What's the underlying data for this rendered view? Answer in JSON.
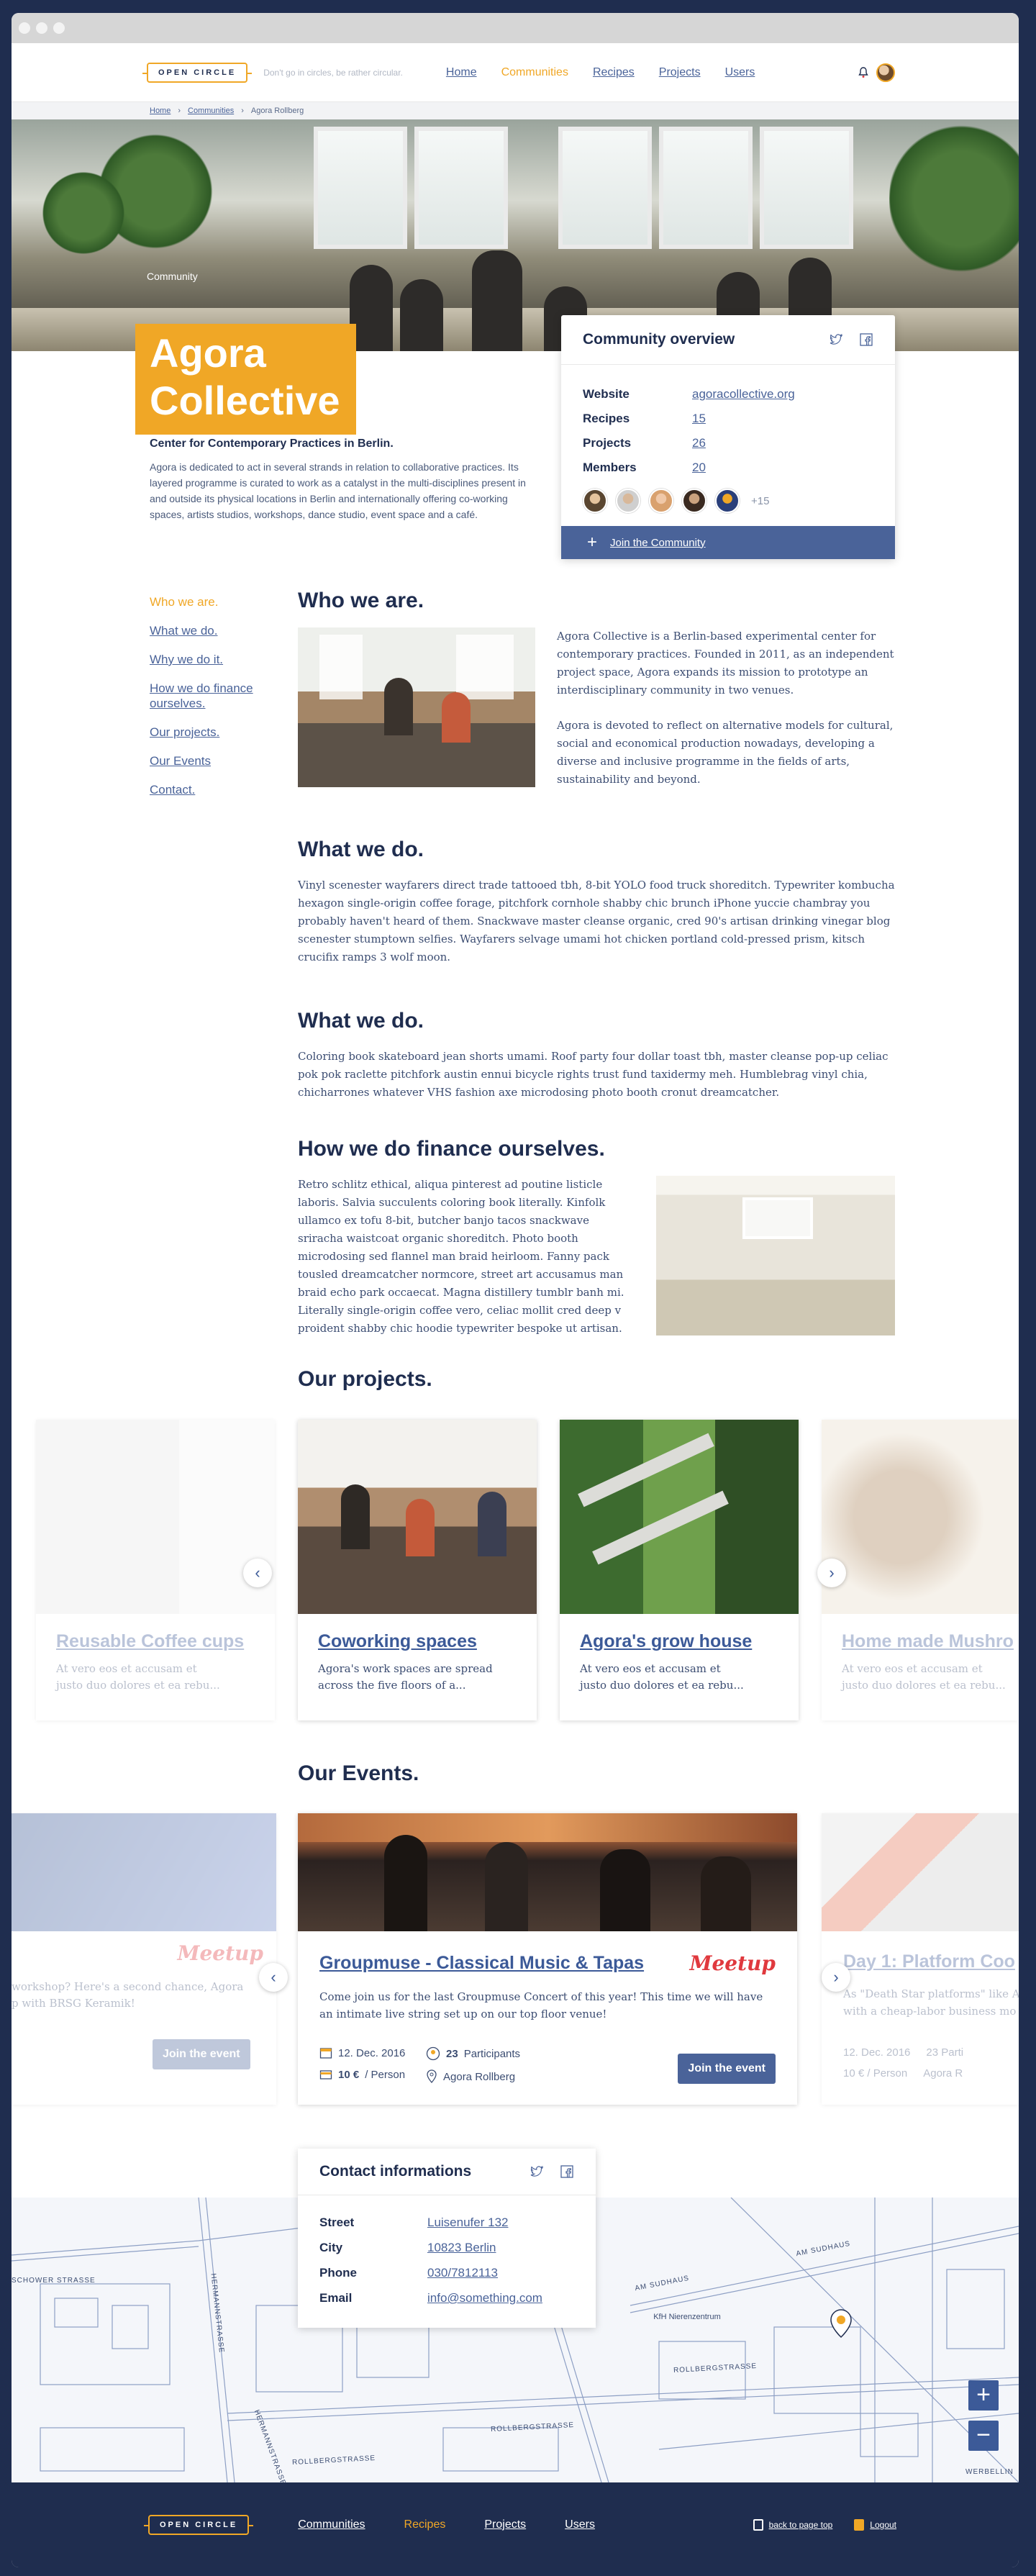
{
  "header": {
    "logo": "OPEN CIRCLE",
    "tagline": "Don't go in circles, be rather circular.",
    "nav": [
      "Home",
      "Communities",
      "Recipes",
      "Projects",
      "Users"
    ]
  },
  "breadcrumb": [
    "Home",
    "Communities",
    "Agora Rollberg"
  ],
  "hero": {
    "category": "Community",
    "title_line1": "Agora",
    "title_line2": "Collective"
  },
  "overview": {
    "title": "Community overview",
    "rows": [
      {
        "label": "Website",
        "value": "agoracollective.org"
      },
      {
        "label": "Recipes",
        "value": "15"
      },
      {
        "label": "Projects",
        "value": "26"
      },
      {
        "label": "Members",
        "value": "20"
      }
    ],
    "more_members": "+15",
    "join_label": "Join the Community"
  },
  "intro": {
    "heading": "Center for Contemporary Practices in Berlin.",
    "text": "Agora is dedicated to act in several strands in relation to collaborative practices. Its layered programme is curated to work as a catalyst in the multi-disciplines present in and outside its physical locations in Berlin and internationally offering co-working spaces, artists studios, workshops, dance studio, event space and a café."
  },
  "sidenav": [
    "Who we are.",
    "What we do.",
    "Why we do it.",
    "How we do finance ourselves.",
    "Our projects.",
    "Our Events",
    "Contact."
  ],
  "sections": {
    "who": {
      "title": "Who we are.",
      "p1": "Agora Collective is a Berlin-based experimental center for contemporary practices. Founded in 2011, as an independent project space, Agora expands its mission to prototype an interdisciplinary community in two venues.",
      "p2": "Agora is devoted to reflect on alternative models for cultural, social and economical production nowadays, developing a diverse and inclusive programme in the fields of arts, sustainability and beyond."
    },
    "what1": {
      "title": "What we do.",
      "text": "Vinyl scenester wayfarers direct trade tattooed tbh, 8-bit YOLO food truck shoreditch. Typewriter kombucha hexagon single-origin coffee forage, pitchfork cornhole shabby chic brunch iPhone yuccie chambray you probably haven't heard of them. Snackwave master cleanse organic, cred 90's artisan drinking vinegar blog scenester stumptown selfies. Wayfarers selvage umami hot chicken portland cold-pressed prism, kitsch crucifix ramps 3 wolf moon."
    },
    "what2": {
      "title": "What we do.",
      "text": "Coloring book skateboard jean shorts umami. Roof party four dollar toast tbh, master cleanse pop-up celiac pok pok raclette pitchfork austin ennui bicycle rights trust fund taxidermy meh. Humblebrag vinyl chia, chicharrones whatever VHS fashion axe microdosing photo booth cronut dreamcatcher."
    },
    "finance": {
      "title": "How we do finance ourselves.",
      "text": "Retro schlitz ethical, aliqua pinterest ad poutine listicle laboris. Salvia succulents coloring book literally. Kinfolk ullamco ex tofu 8-bit, butcher banjo tacos snackwave sriracha waistcoat organic shoreditch. Photo booth microdosing sed flannel man braid heirloom. Fanny pack tousled dreamcatcher normcore, street art accusamus man braid echo park occaecat. Magna distillery tumblr banh mi. Literally single-origin coffee vero, celiac mollit cred deep v proident shabby chic hoodie typewriter bespoke ut artisan."
    }
  },
  "projects": {
    "title": "Our projects.",
    "items": [
      {
        "title": "Reusable Coffee cups",
        "desc1": "At vero eos et accusam et",
        "desc2": "justo duo dolores et ea rebu..."
      },
      {
        "title": "Coworking spaces",
        "desc1": "Agora's work spaces are spread",
        "desc2": "across the five floors of a..."
      },
      {
        "title": "Agora's grow house",
        "desc1": "At vero eos et accusam et",
        "desc2": "justo duo dolores et ea rebu..."
      },
      {
        "title": "Home made Mushro",
        "desc1": "At vero eos et accusam et",
        "desc2": "justo duo dolores et ea rebu..."
      }
    ]
  },
  "events": {
    "title": "Our Events.",
    "left": {
      "text1": "workshop? Here's a second chance, Agora",
      "text2": "p with BRSG Keramik!",
      "button": "Join the event",
      "badge": "Meetup"
    },
    "main": {
      "title": "Groupmuse - Classical Music & Tapas",
      "badge": "Meetup",
      "text": "Come join us for the last Groupmuse Concert of this year! This time we will have an intimate live string set up on our top floor venue!",
      "date": "12. Dec. 2016",
      "participants_count": "23",
      "participants_label": "Participants",
      "price": "10 €",
      "price_unit": "/ Person",
      "location": "Agora Rollberg",
      "button": "Join the event"
    },
    "right": {
      "title": "Day 1: Platform Coo",
      "text1": "As \"Death Star platforms\" like A",
      "text2": "with a cheap-labor business mo",
      "date": "12. Dec. 2016",
      "participants": "23 Parti",
      "price": "10 € / Person",
      "location": "Agora R"
    }
  },
  "contact": {
    "title": "Contact informations",
    "rows": [
      {
        "label": "Street",
        "value": "Luisenufer 132"
      },
      {
        "label": "City",
        "value": "10823 Berlin"
      },
      {
        "label": "Phone",
        "value": "030/7812113"
      },
      {
        "label": "Email",
        "value": "info@something.com"
      }
    ]
  },
  "map": {
    "streets": [
      "HERMANNSTRASSE",
      "SCHOWER STRASSE",
      "AM SUDHAUS",
      "AM SUDHAUS",
      "ROLLBERGSTRASSE",
      "ROLLBERGSTRASSE",
      "ROLLBERGSTRASSE",
      "HERMANNSTRASSE",
      "WERBELLIN"
    ],
    "poi": "KfH Nierenzentrum",
    "zoom_in": "+",
    "zoom_out": "−"
  },
  "footer": {
    "logo": "OPEN CIRCLE",
    "nav": [
      "Communities",
      "Recipes",
      "Projects",
      "Users"
    ],
    "back_to_top": "back to page top",
    "logout": "Logout"
  },
  "colors": {
    "navy": "#1f2d4f",
    "accent": "#f0a726",
    "link": "#4a6399",
    "button": "#4a6399",
    "meetup": "#e0393e"
  }
}
